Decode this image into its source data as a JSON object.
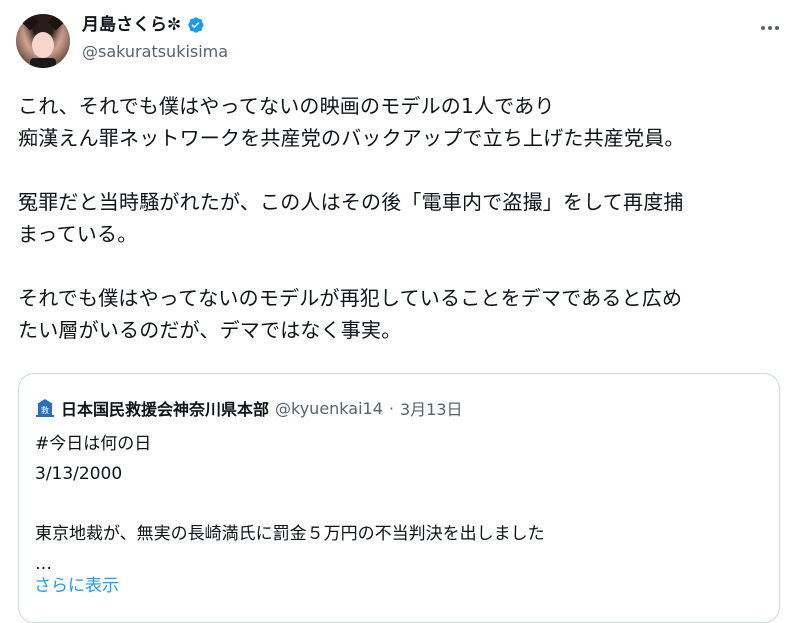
{
  "author": {
    "display_name": "月島さくら✼",
    "handle": "@sakuratsukisima",
    "verified": true,
    "verified_color": "#1d9bf0",
    "avatar_icon": "avatar-photo"
  },
  "more_icon": "more-horizontal-icon",
  "tweet": {
    "text": "これ、それでも僕はやってないの映画のモデルの1人であり\n痴漢えん罪ネットワークを共産党のバックアップで立ち上げた共産党員。\n\n冤罪だと当時騒がれたが、この人はその後「電車内で盗撮」をして再度捕\nまっている。\n\nそれでも僕はやってないのモデルが再犯していることをデマであると広め\nたい層がいるのだが、デマではなく事実。"
  },
  "quote": {
    "display_name": "日本国民救援会神奈川県本部",
    "handle": "@kyuenkai14",
    "separator": "·",
    "date": "3月13日",
    "text": "#今日は何の日\n3/13/2000\n\n東京地裁が、無実の長崎満氏に罰金５万円の不当判決を出しました\n…",
    "avatar_label": "救",
    "avatar_color": "#2a6fb8"
  },
  "show_more": "さらに表示",
  "colors": {
    "text": "#0f1419",
    "secondary": "#536471",
    "link": "#1d9bf0",
    "border": "#cfd9de"
  }
}
